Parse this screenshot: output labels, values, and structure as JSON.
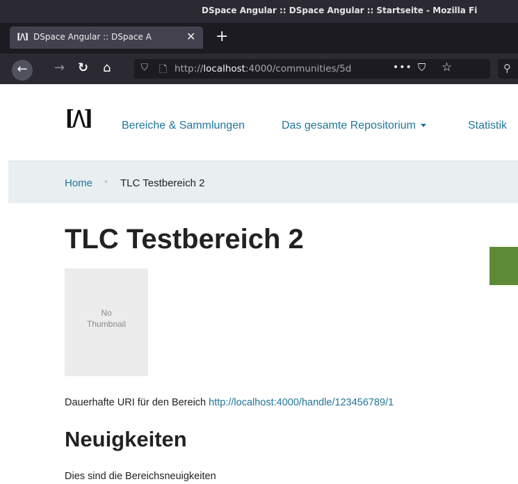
{
  "browser": {
    "window_title": "DSpace Angular :: DSpace Angular :: Startseite - Mozilla Fi",
    "tab_label": "DSpace Angular :: DSpace A",
    "favicon_text": "[/\\]",
    "new_tab_symbol": "+",
    "url_prefix": "http://",
    "url_host": "localhost",
    "url_rest": ":4000/communities/5d",
    "icons": [
      "back-arrow-icon",
      "forward-arrow-icon",
      "reload-icon",
      "home-icon",
      "shield-icon",
      "page-icon",
      "more-icon",
      "pocket-icon",
      "star-icon",
      "search-icon",
      "close-icon"
    ]
  },
  "header": {
    "logo_text": "[/\\]",
    "nav": {
      "communities": "Bereiche & Sammlungen",
      "repository": "Das gesamte Repositorium",
      "statistics": "Statistik"
    }
  },
  "breadcrumb": {
    "home": "Home",
    "separator": "•",
    "current": "TLC Testbereich 2"
  },
  "main": {
    "title": "TLC Testbereich 2",
    "thumbnail_line1": "No",
    "thumbnail_line2": "Thumbnail",
    "uri_label": "Dauerhafte URI für den Bereich",
    "uri_link": "http://localhost:4000/handle/123456789/1",
    "news_title": "Neuigkeiten",
    "news_text": "Dies sind die Bereichsneuigkeiten"
  },
  "colors": {
    "link": "#207698",
    "action_button": "#5d8a34",
    "breadcrumb_bg": "#e9eef1"
  }
}
